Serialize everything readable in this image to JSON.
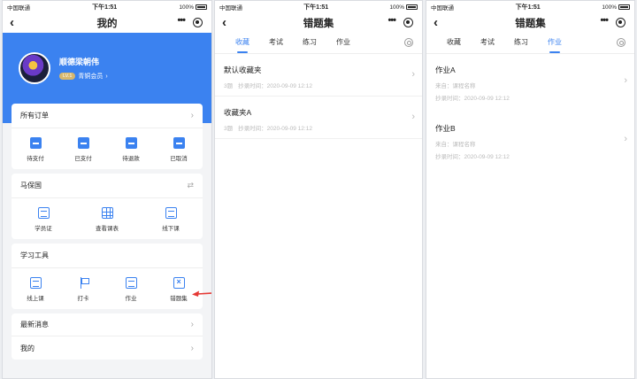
{
  "status": {
    "carrier": "中国联通",
    "time": "下午1:51",
    "battery": "100%"
  },
  "panel1": {
    "nav_title": "我的",
    "profile": {
      "name": "顺德梁朝伟",
      "level": "LV.1",
      "member": "青铜会员"
    },
    "orders": {
      "title": "所有订单",
      "items": [
        {
          "label": "待支付",
          "icon": "wallet-icon"
        },
        {
          "label": "已支付",
          "icon": "paid-icon"
        },
        {
          "label": "待退款",
          "icon": "refund-icon"
        },
        {
          "label": "已取消",
          "icon": "cancel-icon"
        }
      ]
    },
    "org": {
      "title": "马保国",
      "items": [
        {
          "label": "学员证",
          "icon": "id-card-icon"
        },
        {
          "label": "查看课表",
          "icon": "timetable-icon"
        },
        {
          "label": "线下课",
          "icon": "document-icon"
        }
      ]
    },
    "tools": {
      "title": "学习工具",
      "items": [
        {
          "label": "线上课",
          "icon": "online-course-icon"
        },
        {
          "label": "打卡",
          "icon": "flag-icon"
        },
        {
          "label": "作业",
          "icon": "homework-icon"
        },
        {
          "label": "错题集",
          "icon": "wrong-questions-icon"
        }
      ]
    },
    "rows": [
      "最新消息",
      "我的"
    ]
  },
  "panel2": {
    "nav_title": "错题集",
    "tabs": [
      "收藏",
      "考试",
      "练习",
      "作业"
    ],
    "active_tab": 0,
    "items": [
      {
        "title": "默认收藏夹",
        "count": "3题",
        "time": "抄录时间：2020-09-09 12:12"
      },
      {
        "title": "收藏夹A",
        "count": "3题",
        "time": "抄录时间：2020-09-09 12:12"
      }
    ]
  },
  "panel3": {
    "nav_title": "错题集",
    "tabs": [
      "收藏",
      "考试",
      "练习",
      "作业"
    ],
    "active_tab": 3,
    "items": [
      {
        "title": "作业A",
        "source": "来自：课程名称",
        "time": "抄录时间：2020-09-09 12:12"
      },
      {
        "title": "作业B",
        "source": "来自：课程名称",
        "time": "抄录时间：2020-09-09 12:12"
      }
    ]
  },
  "colors": {
    "accent": "#3b82f0",
    "arrow": "#e53935"
  }
}
